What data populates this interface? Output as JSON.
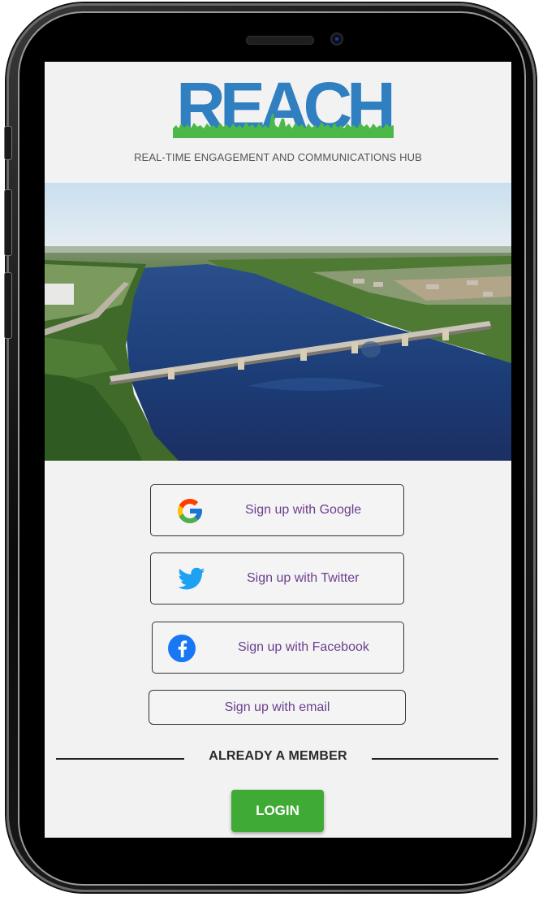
{
  "app": {
    "logo_text": "REACH",
    "tagline": "REAL-TIME ENGAGEMENT AND COMMUNICATIONS HUB",
    "brand_color": "#2f7fc1",
    "grass_color": "#4cb848"
  },
  "signup": {
    "google_label": "Sign up with Google",
    "twitter_label": "Sign up with Twitter",
    "facebook_label": "Sign up with Facebook",
    "email_label": "Sign up with email"
  },
  "member": {
    "divider_text": "ALREADY A MEMBER",
    "login_label": "LOGIN"
  },
  "colors": {
    "link_text": "#6b3f8f",
    "login_button": "#3fab35"
  },
  "icons": [
    "google-g-icon",
    "twitter-bird-icon",
    "facebook-f-icon"
  ]
}
